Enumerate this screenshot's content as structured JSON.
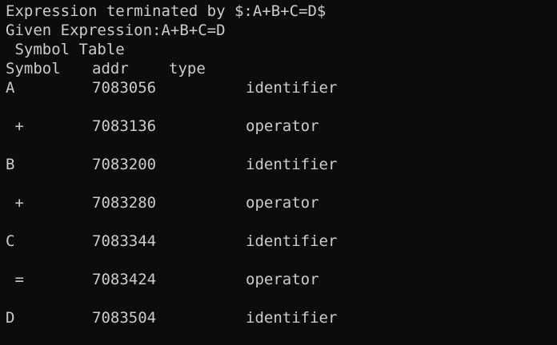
{
  "terminal": {
    "line1": "Expression terminated by $:A+B+C=D$",
    "line2": "Given Expression:A+B+C=D",
    "table_title": " Symbol Table",
    "headers": [
      "Symbol",
      "addr",
      "type"
    ],
    "rows": [
      {
        "symbol": "A",
        "addr": "7083056",
        "type": "identifier"
      },
      {
        "symbol": " +",
        "addr": "7083136",
        "type": "operator"
      },
      {
        "symbol": "B",
        "addr": "7083200",
        "type": "identifier"
      },
      {
        "symbol": " +",
        "addr": "7083280",
        "type": "operator"
      },
      {
        "symbol": "C",
        "addr": "7083344",
        "type": "identifier"
      },
      {
        "symbol": " =",
        "addr": "7083424",
        "type": "operator"
      },
      {
        "symbol": "D",
        "addr": "7083504",
        "type": "identifier"
      }
    ],
    "colors": {
      "background": "#0c0c0c",
      "text": "#cccccc"
    }
  }
}
